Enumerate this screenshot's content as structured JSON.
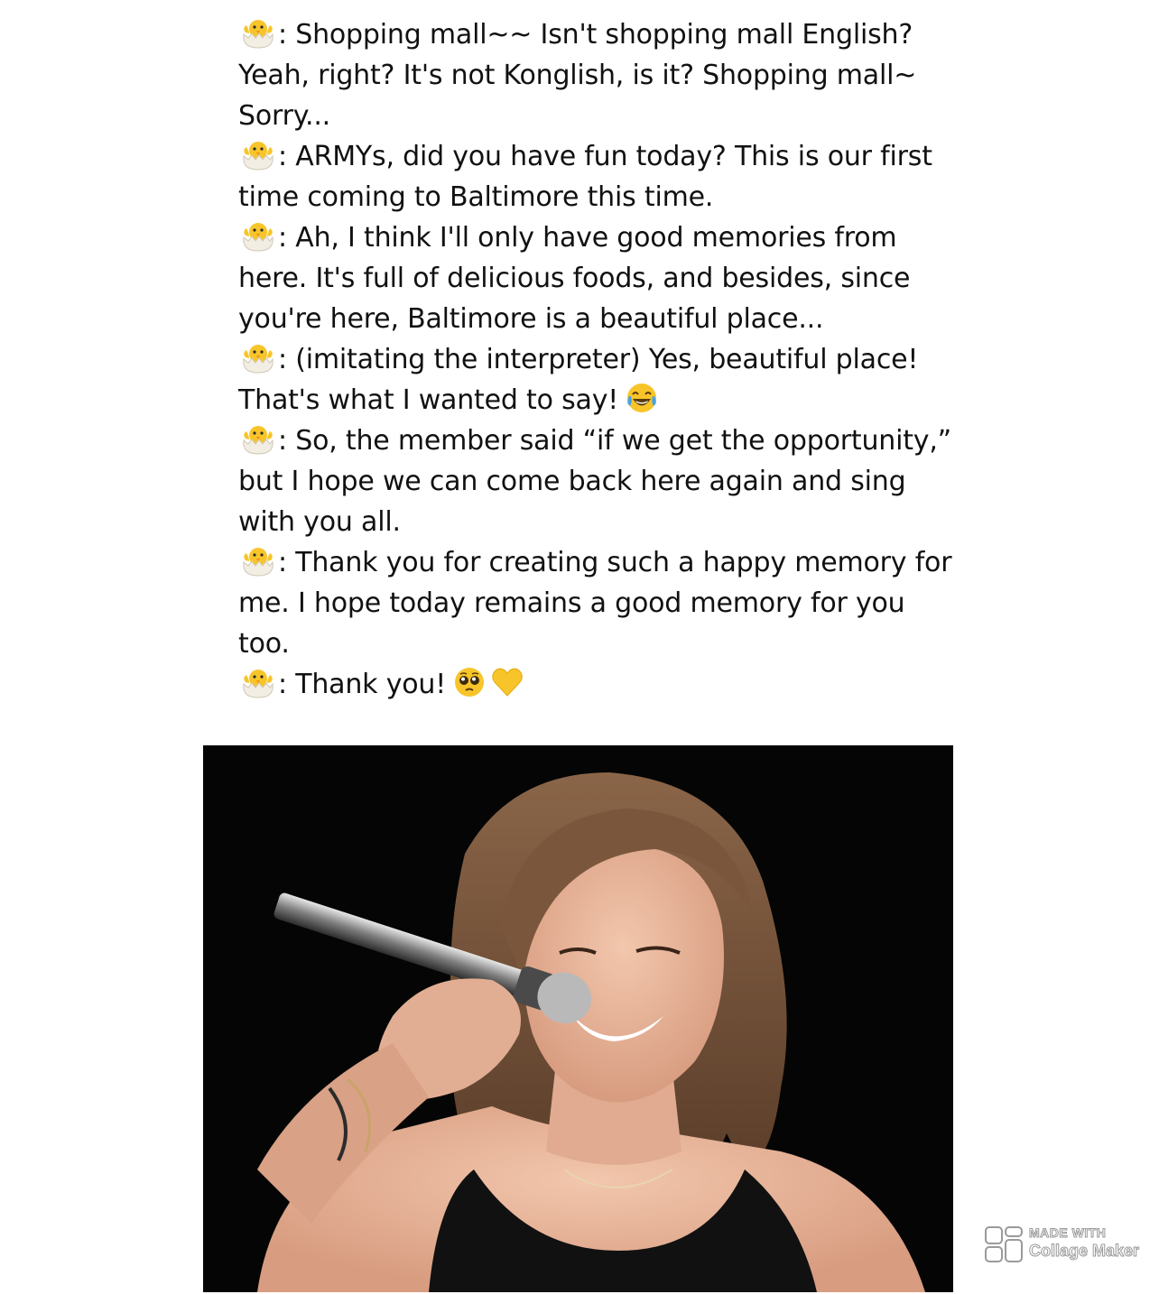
{
  "lines": [
    {
      "speaker_icon": "hatching-chick-icon",
      "text": ": Shopping mall~~ Isn't shopping mall English? Yeah, right? It's not Konglish, is it? Shopping mall~ Sorry..."
    },
    {
      "speaker_icon": "hatching-chick-icon",
      "text": ": ARMYs, did you have fun today? This is our first time coming to Baltimore this time."
    },
    {
      "speaker_icon": "hatching-chick-icon",
      "text": ": Ah, I think I'll only have good memories from here. It's full of delicious foods, and besides, since you're here, Baltimore is a beautiful place..."
    },
    {
      "speaker_icon": "hatching-chick-icon",
      "text": ": (imitating the interpreter) Yes, beautiful place! That's what I wanted to say!",
      "trailing_emoji": [
        "tears-of-joy-icon"
      ]
    },
    {
      "speaker_icon": "hatching-chick-icon",
      "text": ": So, the member said “if we get the opportunity,” but I hope we can come back here again and sing with you all."
    },
    {
      "speaker_icon": "hatching-chick-icon",
      "text": ": Thank you for creating such a happy memory for me. I hope today remains a good memory for you too."
    },
    {
      "speaker_icon": "hatching-chick-icon",
      "text": ": Thank you!",
      "trailing_emoji": [
        "pleading-face-icon",
        "yellow-heart-icon"
      ]
    }
  ],
  "watermark": {
    "line1": "MADE WITH",
    "line2": "Collage Maker"
  },
  "colors": {
    "background": "#ffffff",
    "text": "#111111",
    "photo_background": "#050505",
    "chick": "#f7c52a",
    "heart": "#f7c52a"
  }
}
